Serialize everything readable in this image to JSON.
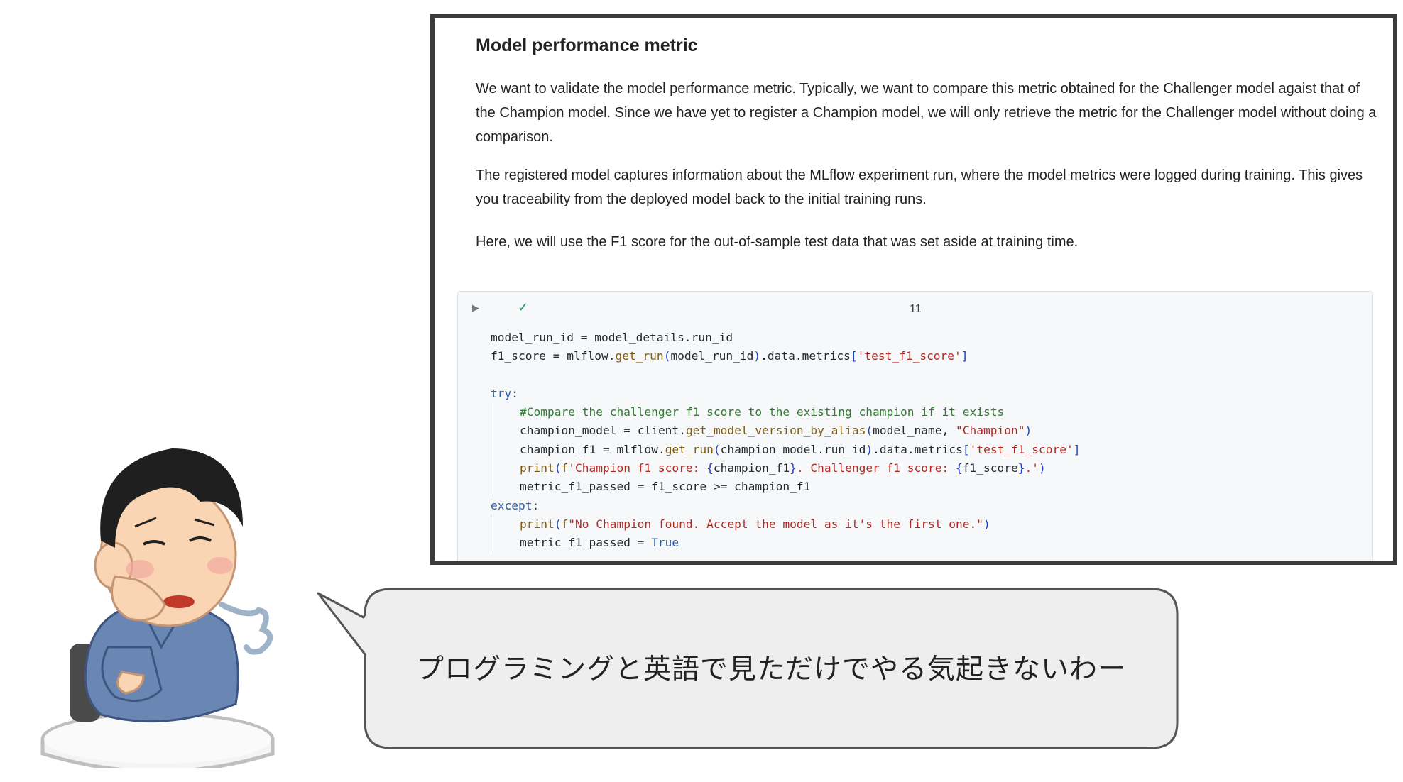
{
  "notebook": {
    "heading": "Model performance metric",
    "paragraphs": [
      "We want to validate the model performance metric. Typically, we want to compare this metric obtained for the Challenger model agaist that of the Champion model. Since we have yet to register a Champion model, we will only retrieve the metric for the Challenger model without doing a comparison.",
      "The registered model captures information about the MLflow experiment run, where the model metrics were logged during training. This gives you traceability from the deployed model back to the initial training runs.",
      "Here, we will use the F1 score for the out-of-sample test data that was set aside at training time."
    ],
    "cell": {
      "run_icon": "play-triangle-icon",
      "status_icon": "checkmark-icon",
      "execution_count": "11",
      "code_lines": [
        "model_run_id = model_details.run_id",
        "f1_score = mlflow.get_run(model_run_id).data.metrics['test_f1_score']",
        "",
        "try:",
        "    #Compare the challenger f1 score to the existing champion if it exists",
        "    champion_model = client.get_model_version_by_alias(model_name, \"Champion\")",
        "    champion_f1 = mlflow.get_run(champion_model.run_id).data.metrics['test_f1_score']",
        "    print(f'Champion f1 score: {champion_f1}. Challenger f1 score: {f1_score}.')",
        "    metric_f1_passed = f1_score >= champion_f1",
        "except:",
        "    print(f\"No Champion found. Accept the model as it's the first one.\")",
        "    metric_f1_passed = True"
      ]
    }
  },
  "speech_bubble": {
    "text": "プログラミングと英語で見ただけでやる気起きないわー"
  },
  "illustration": {
    "icon": "bored-man-at-desk-icon"
  },
  "colors": {
    "panel_border": "#3b3b3b",
    "code_keyword": "#2f5fa8",
    "code_string": "#b02a24",
    "code_comment": "#2f7d2f",
    "bubble_fill": "#eeeeee"
  }
}
